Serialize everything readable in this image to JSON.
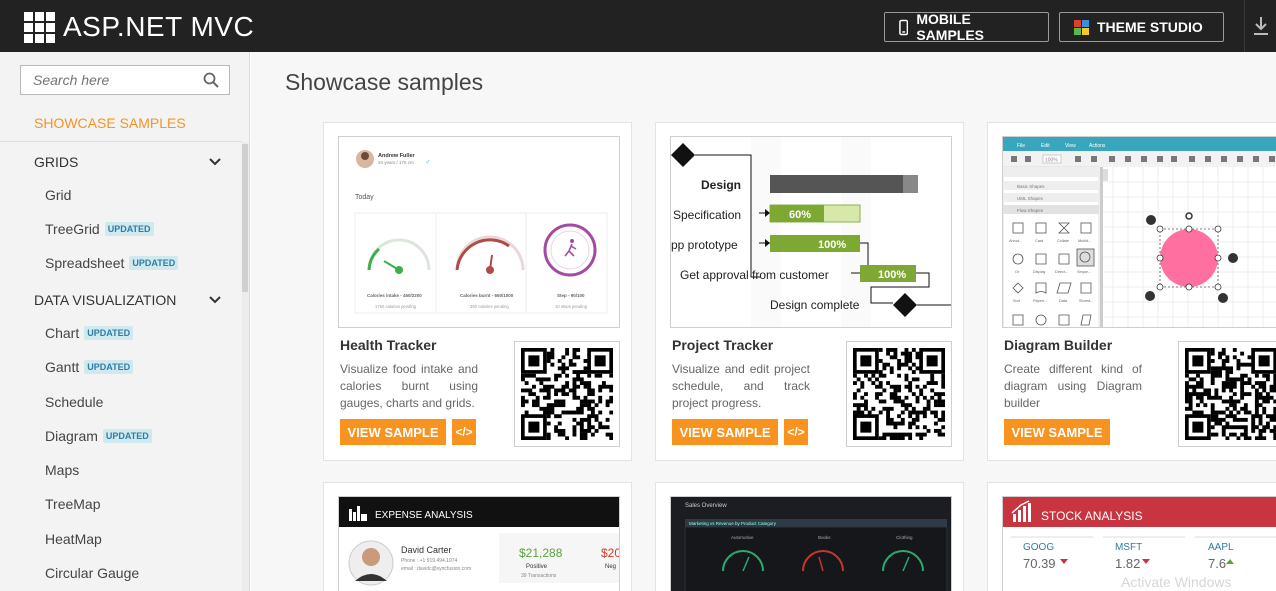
{
  "header": {
    "logo_text": "ASP.NET MVC",
    "mobile_label": "MOBILE SAMPLES",
    "theme_label": "THEME STUDIO"
  },
  "sidebar": {
    "search_placeholder": "Search here",
    "showcase_label": "SHOWCASE SAMPLES",
    "sections": [
      {
        "label": "GRIDS",
        "items": [
          {
            "label": "Grid",
            "badge": ""
          },
          {
            "label": "TreeGrid",
            "badge": "UPDATED"
          },
          {
            "label": "Spreadsheet",
            "badge": "UPDATED"
          }
        ]
      },
      {
        "label": "DATA VISUALIZATION",
        "items": [
          {
            "label": "Chart",
            "badge": "UPDATED"
          },
          {
            "label": "Gantt",
            "badge": "UPDATED"
          },
          {
            "label": "Schedule",
            "badge": ""
          },
          {
            "label": "Diagram",
            "badge": "UPDATED"
          },
          {
            "label": "Maps",
            "badge": ""
          },
          {
            "label": "TreeMap",
            "badge": ""
          },
          {
            "label": "HeatMap",
            "badge": ""
          },
          {
            "label": "Circular Gauge",
            "badge": ""
          }
        ]
      }
    ]
  },
  "main": {
    "page_title": "Showcase samples",
    "view_label": "VIEW SAMPLE",
    "code_label": "</>",
    "cards": [
      {
        "title": "Health Tracker",
        "description": "Visualize food intake and calories burnt using gauges, charts and grids."
      },
      {
        "title": "Project Tracker",
        "description": "Visualize and edit project schedule, and track project progress."
      },
      {
        "title": "Diagram Builder",
        "description": "Create different kind of diagram using Diagram builder"
      }
    ],
    "health_thumb": {
      "user_name": "Andrew Fuller",
      "user_info": "34 years / 175 cm",
      "today_label": "Today",
      "gauges": [
        {
          "label": "Calories intake - 450/2200",
          "sub": "1750 calories pending",
          "color": "#3fae49",
          "level": 0.2
        },
        {
          "label": "Calories burnt - 650/1000",
          "sub": "350 calories pending",
          "color": "#b34a49",
          "level": 0.65
        },
        {
          "label": "Step - 90/100",
          "sub": "10 steps pending",
          "color": "#a54aa0",
          "level": 0.9
        }
      ]
    },
    "project_thumb": {
      "design_label": "Design",
      "rows": [
        {
          "task": "Specification",
          "pct": "60%"
        },
        {
          "task": "pp prototype",
          "pct": "100%"
        },
        {
          "task": "Get approval from customer",
          "pct": "100%"
        }
      ],
      "complete_label": "Design complete"
    },
    "diagram_thumb": {
      "menu": [
        "File",
        "Edit",
        "View",
        "Actions"
      ],
      "zoom": "100%",
      "panels": [
        "Basic Shapes",
        "UML Shapes",
        "Flow Shapes"
      ],
      "shape_labels": [
        "Annot...",
        "Card",
        "Collate",
        "Multid...",
        "Or",
        "Display",
        "Direct...",
        "Seque...",
        "Sort",
        "Paperl...",
        "Data",
        "Stored..."
      ]
    },
    "expense_thumb": {
      "title": "EXPENSE ANALYSIS",
      "name": "David Carter",
      "phone": "Phone : +1 919.494.1974",
      "email": "email : davidc@syncfusion.com",
      "amount1": "$21,288",
      "amount1_label": "Positive",
      "amount1_sub": "39 Transactions",
      "amount2": "$20",
      "amount2_label": "Neg"
    },
    "sales_thumb": {
      "title": "Sales Overview",
      "subtitle": "Marketing vs Revenue by Product Category",
      "labels": [
        "Automotive",
        "Books",
        "Clothing"
      ]
    },
    "stock_thumb": {
      "title": "STOCK ANALYSIS",
      "tickers": [
        {
          "name": "GOOG",
          "value": "70.39",
          "dir": "down"
        },
        {
          "name": "MSFT",
          "value": "1.82",
          "dir": "down"
        },
        {
          "name": "AAPL",
          "value": "7.6",
          "dir": "up"
        }
      ],
      "watermark": "Activate Windows"
    }
  },
  "colors": {
    "accent": "#f7931e",
    "topbar": "#222222",
    "badge_bg": "#cfe9ee",
    "badge_fg": "#2f7da3"
  }
}
